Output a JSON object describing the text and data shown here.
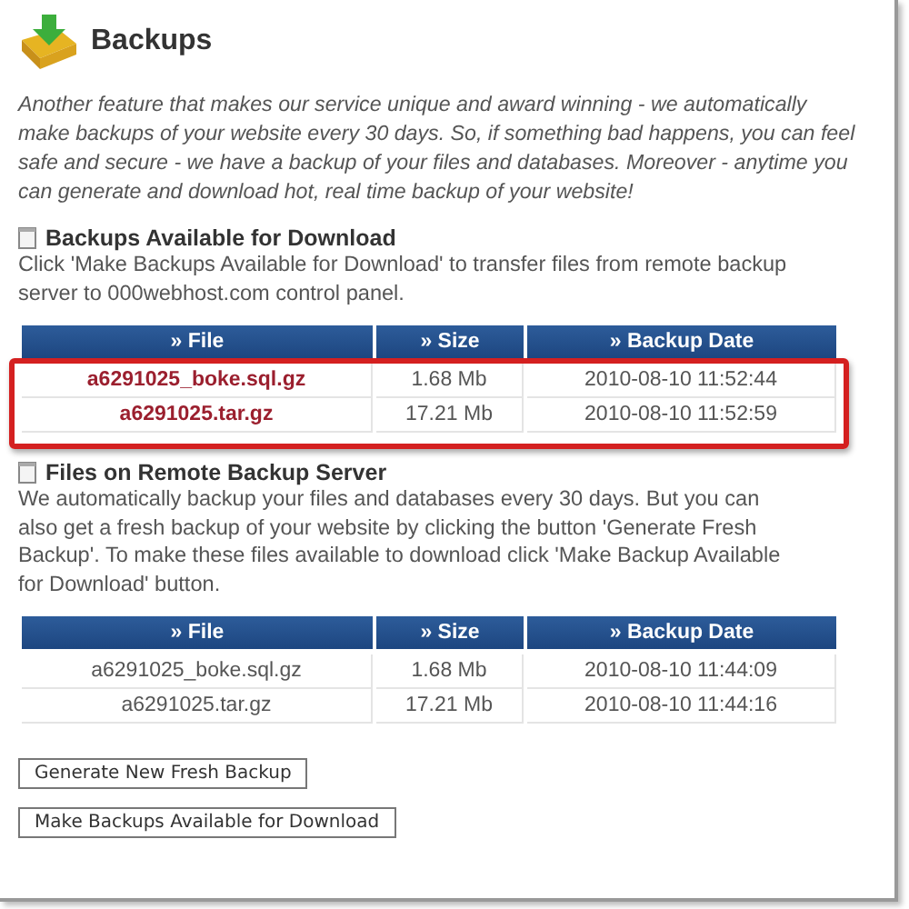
{
  "title": "Backups",
  "intro": "Another feature that makes our service unique and award winning - we automatically make backups of your website every 30 days. So, if something bad happens, you can feel safe and secure - we have a backup of your files and databases. Moreover - anytime you can generate and download hot, real time backup of your website!",
  "sections": [
    {
      "heading": "Backups Available for Download",
      "text": "Click 'Make Backups Available for Download' to transfer files from remote backup server to 000webhost.com control panel.",
      "table": {
        "kind": "download",
        "highlighted": true,
        "columns": [
          "» File",
          "» Size",
          "» Backup Date"
        ],
        "rows": [
          [
            "a6291025_boke.sql.gz",
            "1.68 Mb",
            "2010-08-10 11:52:44"
          ],
          [
            "a6291025.tar.gz",
            "17.21 Mb",
            "2010-08-10 11:52:59"
          ]
        ]
      }
    },
    {
      "heading": "Files on Remote Backup Server",
      "text": "We automatically backup your files and databases every 30 days. But you can also get a fresh backup of your website by clicking the button 'Generate Fresh Backup'. To make these files available to download click 'Make Backup Available for Download' button.",
      "table": {
        "kind": "remote",
        "highlighted": false,
        "columns": [
          "» File",
          "» Size",
          "» Backup Date"
        ],
        "rows": [
          [
            "a6291025_boke.sql.gz",
            "1.68 Mb",
            "2010-08-10 11:44:09"
          ],
          [
            "a6291025.tar.gz",
            "17.21 Mb",
            "2010-08-10 11:44:16"
          ]
        ]
      }
    }
  ],
  "buttons": [
    "Generate New Fresh Backup",
    "Make Backups Available for Download"
  ]
}
